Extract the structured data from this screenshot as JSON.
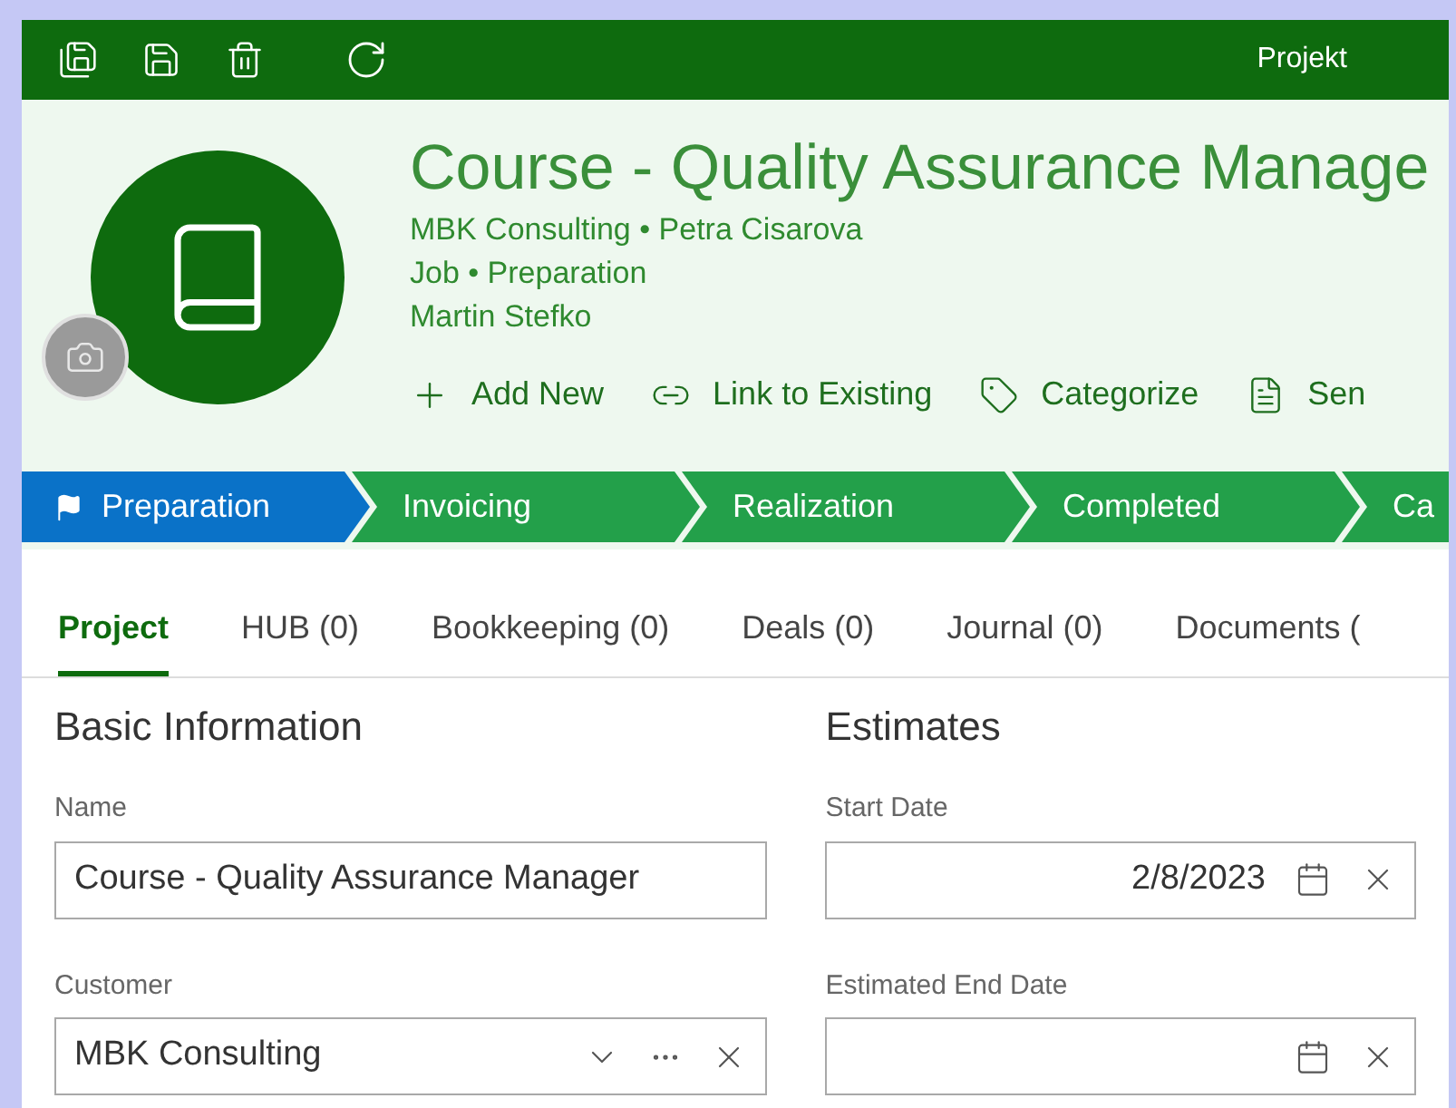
{
  "window": {
    "title": "Projekt"
  },
  "header": {
    "title": "Course - Quality Assurance Manage",
    "lines": [
      "MBK Consulting • Petra Cisarova",
      "Job • Preparation",
      "Martin Stefko"
    ]
  },
  "actions": [
    {
      "kind": "add",
      "label": "Add New"
    },
    {
      "kind": "link",
      "label": "Link to Existing"
    },
    {
      "kind": "tag",
      "label": "Categorize"
    },
    {
      "kind": "pdf",
      "label": "Sen"
    }
  ],
  "stages": [
    {
      "label": "Preparation",
      "selected": true
    },
    {
      "label": "Invoicing",
      "selected": false
    },
    {
      "label": "Realization",
      "selected": false
    },
    {
      "label": "Completed",
      "selected": false
    },
    {
      "label": "Ca",
      "selected": false
    }
  ],
  "tabs": [
    {
      "label": "Project",
      "selected": true
    },
    {
      "label": "HUB (0)",
      "selected": false
    },
    {
      "label": "Bookkeeping (0)",
      "selected": false
    },
    {
      "label": "Deals (0)",
      "selected": false
    },
    {
      "label": "Journal (0)",
      "selected": false
    },
    {
      "label": "Documents (",
      "selected": false
    }
  ],
  "sections": [
    {
      "title": "Basic Information",
      "fields": [
        {
          "kind": "text",
          "label": "Name",
          "value": "Course - Quality Assurance Manager"
        },
        {
          "kind": "lookup",
          "label": "Customer",
          "value": "MBK Consulting"
        }
      ]
    },
    {
      "title": "Estimates",
      "fields": [
        {
          "kind": "date",
          "label": "Start Date",
          "value": "2/8/2023"
        },
        {
          "kind": "date",
          "label": "Estimated End Date"
        }
      ]
    }
  ]
}
